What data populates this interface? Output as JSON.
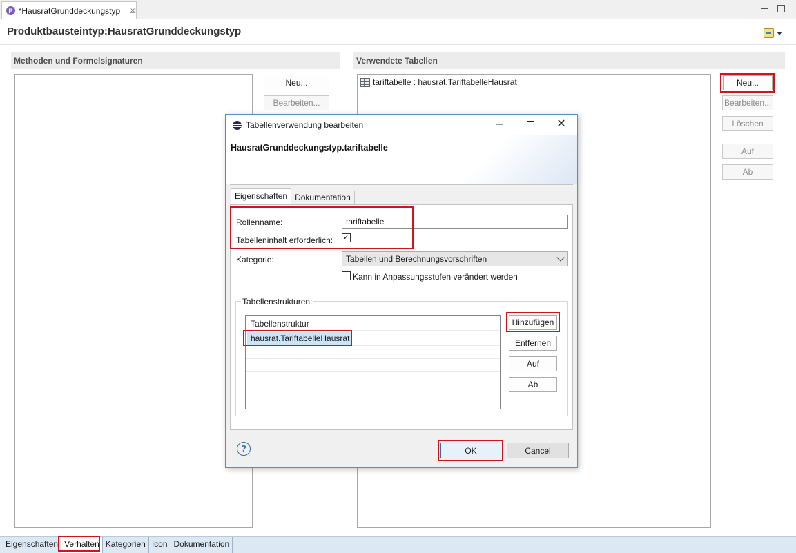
{
  "editor": {
    "tab_label": "*HausratGrunddeckungstyp",
    "tab_close": "☒",
    "title": "Produktbausteintyp:HausratGrunddeckungstyp"
  },
  "methods_section": {
    "title": "Methoden und Formelsignaturen",
    "new_button": "Neu...",
    "edit_button": "Bearbeiten..."
  },
  "tables_section": {
    "title": "Verwendete Tabellen",
    "items": [
      "tariftabelle : hausrat.TariftabelleHausrat"
    ],
    "buttons": {
      "new": "Neu...",
      "edit": "Bearbeiten...",
      "delete": "Löschen",
      "up": "Auf",
      "down": "Ab"
    }
  },
  "bottom_tabs": [
    "Eigenschaften",
    "Verhalten",
    "Kategorien",
    "Icon",
    "Dokumentation"
  ],
  "bottom_tabs_active": "Verhalten",
  "dialog": {
    "title": "Tabellenverwendung bearbeiten",
    "subtitle": "HausratGrunddeckungstyp.tariftabelle",
    "tabs": [
      "Eigenschaften",
      "Dokumentation"
    ],
    "active_tab": "Eigenschaften",
    "fields": {
      "rollenname_label": "Rollenname:",
      "rollenname_value": "tariftabelle",
      "required_label": "Tabelleninhalt erforderlich:",
      "required_checked": true,
      "kategorie_label": "Kategorie:",
      "kategorie_value": "Tabellen und Berechnungsvorschriften",
      "anpassung_label": "Kann in Anpassungsstufen verändert werden",
      "anpassung_checked": false
    },
    "structures": {
      "group_label": "Tabellenstrukturen:",
      "column_header": "Tabellenstruktur",
      "rows": [
        "hausrat.TariftabelleHausrat"
      ],
      "buttons": {
        "add": "Hinzufügen",
        "remove": "Entfernen",
        "up": "Auf",
        "down": "Ab"
      }
    },
    "help_symbol": "?",
    "ok_button": "OK",
    "cancel_button": "Cancel"
  },
  "colors": {
    "highlight": "#d0141b",
    "selection": "#cce4f7",
    "section_header_bg": "#ececec",
    "bottom_tabs_bg": "#dce8f4"
  }
}
